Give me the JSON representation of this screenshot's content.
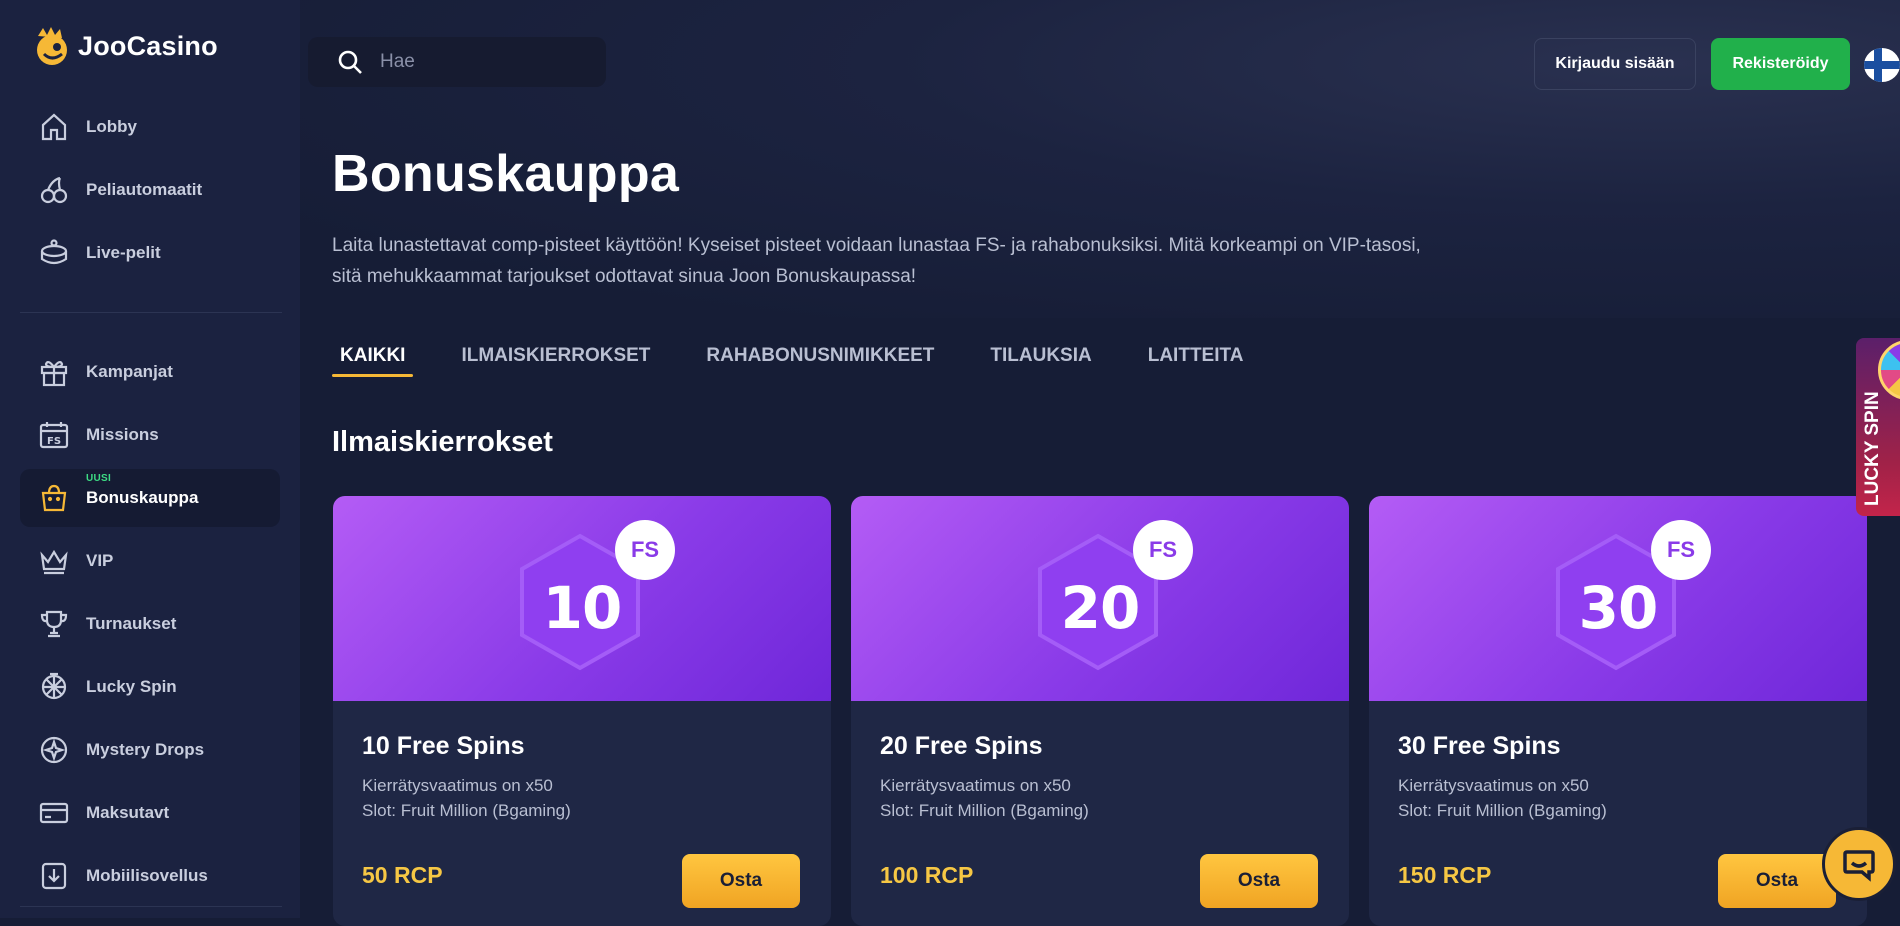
{
  "brand": {
    "name": "JooCasino"
  },
  "sidebar": {
    "items": [
      {
        "label": "Lobby",
        "icon": "home-icon"
      },
      {
        "label": "Peliautomaatit",
        "icon": "cherries-icon"
      },
      {
        "label": "Live-pelit",
        "icon": "live-table-icon"
      },
      {
        "label": "Kampanjat",
        "icon": "gift-icon"
      },
      {
        "label": "Missions",
        "icon": "calendar-fs-icon"
      },
      {
        "label": "Bonuskauppa",
        "icon": "shopping-bag-icon",
        "badge": "UUSI",
        "active": true
      },
      {
        "label": "VIP",
        "icon": "crown-icon"
      },
      {
        "label": "Turnaukset",
        "icon": "trophy-icon"
      },
      {
        "label": "Lucky Spin",
        "icon": "wheel-icon"
      },
      {
        "label": "Mystery Drops",
        "icon": "compass-icon"
      },
      {
        "label": "Maksutavt",
        "icon": "card-icon"
      },
      {
        "label": "Mobiilisovellus",
        "icon": "download-icon"
      }
    ]
  },
  "header": {
    "search_placeholder": "Hae",
    "login_label": "Kirjaudu sisään",
    "register_label": "Rekisteröidy",
    "language": "FI"
  },
  "main": {
    "title": "Bonuskauppa",
    "intro": "Laita lunastettavat comp-pisteet käyttöön! Kyseiset pisteet voidaan lunastaa FS- ja rahabonuksiksi. Mitä korkeampi on VIP-tasosi, sitä mehukkaammat tarjoukset odottavat sinua Joon Bonuskaupassa!",
    "tabs": [
      {
        "label": "KAIKKI",
        "active": true
      },
      {
        "label": "ILMAISKIERROKSET"
      },
      {
        "label": "RAHABONUSNIMIKKEET"
      },
      {
        "label": "TILAUKSIA"
      },
      {
        "label": "LAITTEITA"
      }
    ],
    "section_title": "Ilmaiskierrokset",
    "cards": [
      {
        "number": "10",
        "badge": "FS",
        "title": "10 Free Spins",
        "wager": "Kierrätysvaatimus on x50",
        "slot": "Slot: Fruit Million (Bgaming)",
        "price": "50 RCP",
        "buy_label": "Osta"
      },
      {
        "number": "20",
        "badge": "FS",
        "title": "20 Free Spins",
        "wager": "Kierrätysvaatimus on x50",
        "slot": "Slot: Fruit Million (Bgaming)",
        "price": "100 RCP",
        "buy_label": "Osta"
      },
      {
        "number": "30",
        "badge": "FS",
        "title": "30 Free Spins",
        "wager": "Kierrätysvaatimus on x50",
        "slot": "Slot: Fruit Million (Bgaming)",
        "price": "150 RCP",
        "buy_label": "Osta"
      }
    ]
  },
  "lucky_spin_tab": {
    "label": "LUCKY SPIN"
  },
  "colors": {
    "accent": "#f6b836",
    "register": "#21b04b",
    "card_purple": "#8a3be8",
    "new_badge": "#3ddc84"
  }
}
